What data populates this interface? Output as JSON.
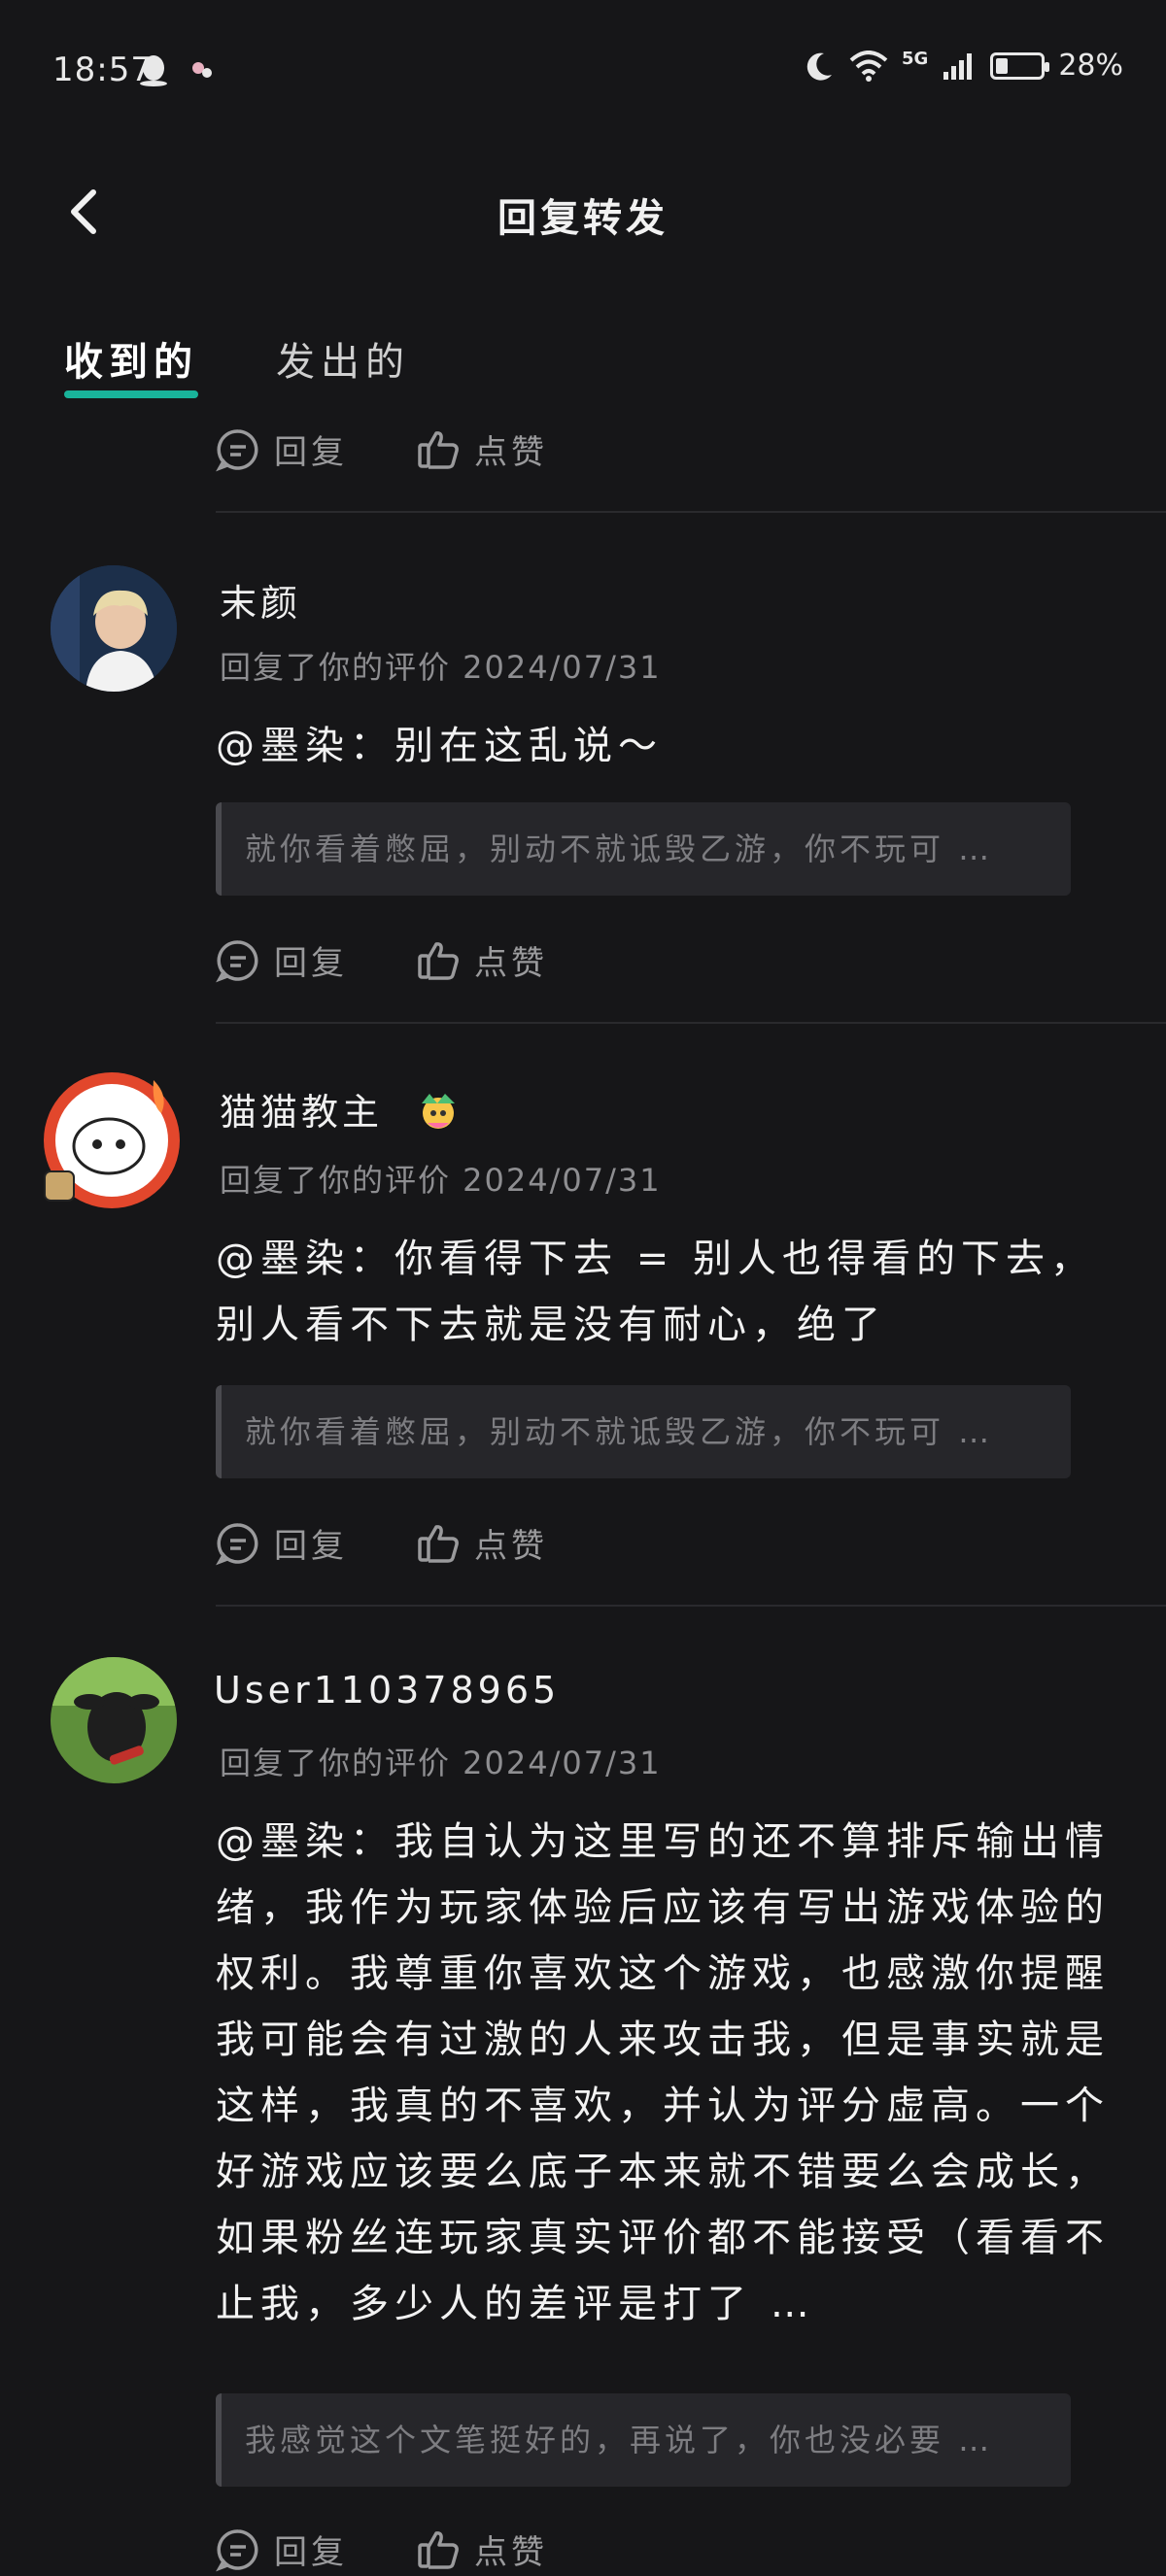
{
  "status": {
    "time": "18:57",
    "network": "5G",
    "battery": "28%",
    "battery_level": 0.28
  },
  "header": {
    "title": "回复转发"
  },
  "tabs": [
    {
      "label": "收到的",
      "active": true
    },
    {
      "label": "发出的",
      "active": false
    }
  ],
  "actions": {
    "reply": "回复",
    "like": "点赞"
  },
  "items": [
    {
      "username": "末颜",
      "meta": "回复了你的评价 2024/07/31",
      "text": "@墨染：别在这乱说～",
      "quote": "就你看着憋屈，别动不就诋毁乙游，你不玩可 …"
    },
    {
      "username": "猫猫教主",
      "meta": "回复了你的评价 2024/07/31",
      "text": "@墨染：你看得下去 = 别人也得看的下去，别人看不下去就是没有耐心，绝了",
      "quote": "就你看着憋屈，别动不就诋毁乙游，你不玩可 …"
    },
    {
      "username": "User110378965",
      "meta": "回复了你的评价 2024/07/31",
      "text": "@墨染：我自认为这里写的还不算排斥输出情绪，我作为玩家体验后应该有写出游戏体验的权利。我尊重你喜欢这个游戏，也感激你提醒我可能会有过激的人来攻击我，但是事实就是这样，我真的不喜欢，并认为评分虚高。一个好游戏应该要么底子本来就不错要么会成长，如果粉丝连玩家真实评价都不能接受（看看不止我，多少人的差评是打了 …",
      "quote": "我感觉这个文笔挺好的，再说了，你也没必要 …"
    }
  ]
}
